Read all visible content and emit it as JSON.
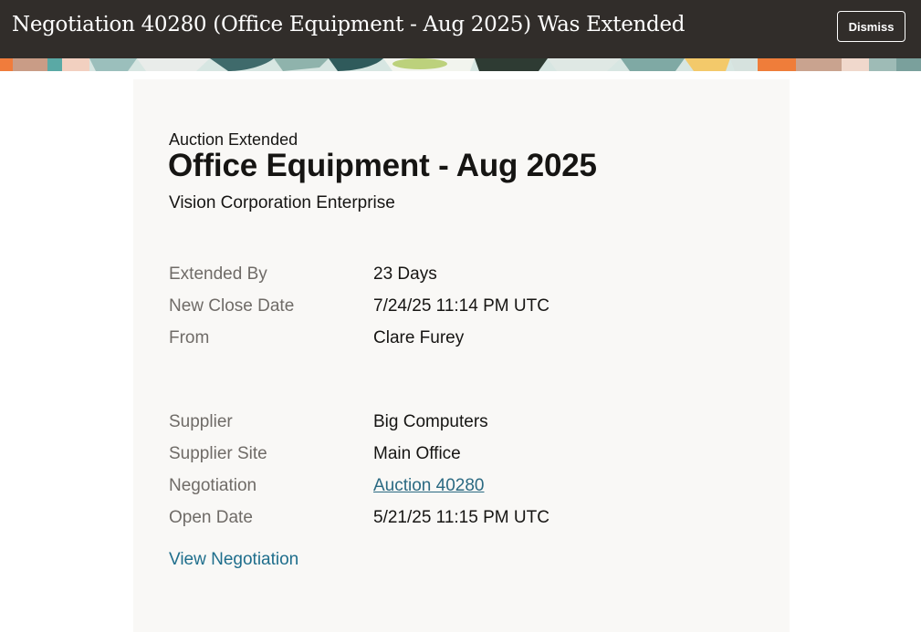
{
  "header": {
    "title": "Negotiation 40280 (Office Equipment - Aug 2025) Was Extended",
    "dismiss_label": "Dismiss"
  },
  "card": {
    "subtitle": "Auction Extended",
    "title": "Office Equipment - Aug 2025",
    "organization": "Vision Corporation Enterprise",
    "extension": [
      {
        "label": "Extended By",
        "value": "23 Days"
      },
      {
        "label": "New Close Date",
        "value": "7/24/25 11:14 PM UTC"
      },
      {
        "label": "From",
        "value": "Clare Furey"
      }
    ],
    "details": [
      {
        "label": "Supplier",
        "value": "Big Computers"
      },
      {
        "label": "Supplier Site",
        "value": "Main Office"
      },
      {
        "label": "Negotiation",
        "value": "Auction 40280"
      },
      {
        "label": "Open Date",
        "value": "5/21/25 11:15 PM UTC"
      }
    ],
    "view_link": "View Negotiation"
  },
  "colors": {
    "header_bg": "#312d2a",
    "card_bg": "#f9f8f6",
    "link": "#1f6e8c",
    "label": "#6f6b67"
  }
}
